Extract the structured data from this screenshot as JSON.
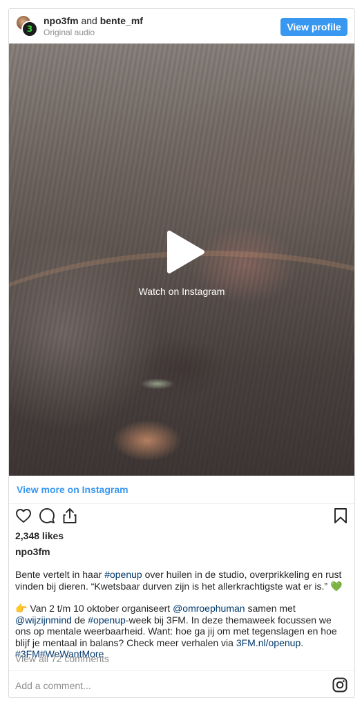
{
  "header": {
    "user_primary": "npo3fm",
    "connector": " and ",
    "user_secondary": "bente_mf",
    "subtitle": "Original audio",
    "view_profile_label": "View profile",
    "avatar_badge": "3"
  },
  "media": {
    "watch_label": "Watch on Instagram",
    "icons": [
      "play-icon"
    ]
  },
  "view_more_label": "View more on Instagram",
  "actions": {
    "icons": [
      "heart-icon",
      "comment-icon",
      "share-icon",
      "bookmark-icon"
    ]
  },
  "likes": "2,348 likes",
  "owner": "npo3fm",
  "caption": {
    "p1_a": "Bente vertelt in haar ",
    "p1_tag": "#openup",
    "p1_b": " over huilen in de studio, overprikkeling en rust vinden bij dieren. “Kwetsbaar durven zijn is het allerkrachtigste wat er is.” ",
    "p1_emoji": "💚",
    "p2_emoji": "👉",
    "p2_a": " Van 2 t/m 10 oktober organiseert ",
    "p2_m1": "@omroephuman",
    "p2_b": " samen met ",
    "p2_m2": "@wijzijnmind",
    "p2_c": " de ",
    "p2_tag1": "#openup",
    "p2_d": "-week bij 3FM. In deze themaweek focussen we ons op mentale weerbaarheid. Want: hoe ga jij om met tegenslagen en hoe blijf je mentaal in balans? Check meer verhalen via ",
    "p2_url": "3FM.nl/openup",
    "p2_e": ". ",
    "p2_tag2": "#3FM",
    "p2_tag3": "#WeWantMore"
  },
  "comments_label": "View all 72 comments",
  "comment_placeholder": "Add a comment...",
  "colors": {
    "accent": "#3897f0",
    "link": "#00376b",
    "muted": "#8e8e8e",
    "text": "#262626",
    "border": "#dbdbdb"
  }
}
